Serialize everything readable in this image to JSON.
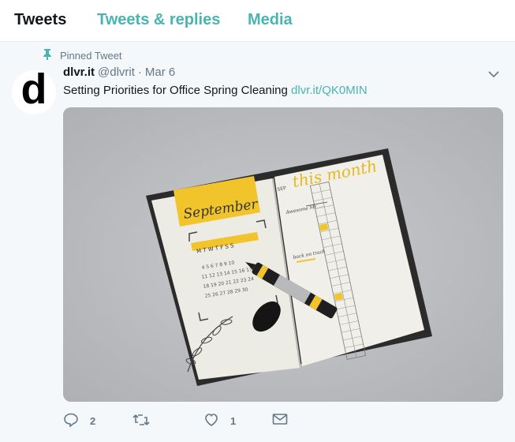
{
  "tabs": [
    {
      "label": "Tweets"
    },
    {
      "label": "Tweets & replies"
    },
    {
      "label": "Media"
    }
  ],
  "tweet": {
    "pinned_label": "Pinned Tweet",
    "avatar_letter": "d",
    "author_name": "dlvr.it",
    "author_handle": "@dlvrit",
    "separator": "·",
    "date": "Mar 6",
    "text": "Setting Priorities for Office Spring Cleaning",
    "link": "dlvr.it/QK0MIN",
    "media": {
      "left_page_title": "September",
      "weekdays": "M T W T F S S",
      "right_page_title": "this month",
      "sep_label": "SEP",
      "note1": "Awesome Mr. ...",
      "note2": "back on track"
    },
    "actions": {
      "reply_count": "2",
      "retweet_count": "",
      "like_count": "1"
    }
  },
  "colors": {
    "accent": "#4ab3b3",
    "text": "#14171a",
    "muted": "#657786"
  }
}
